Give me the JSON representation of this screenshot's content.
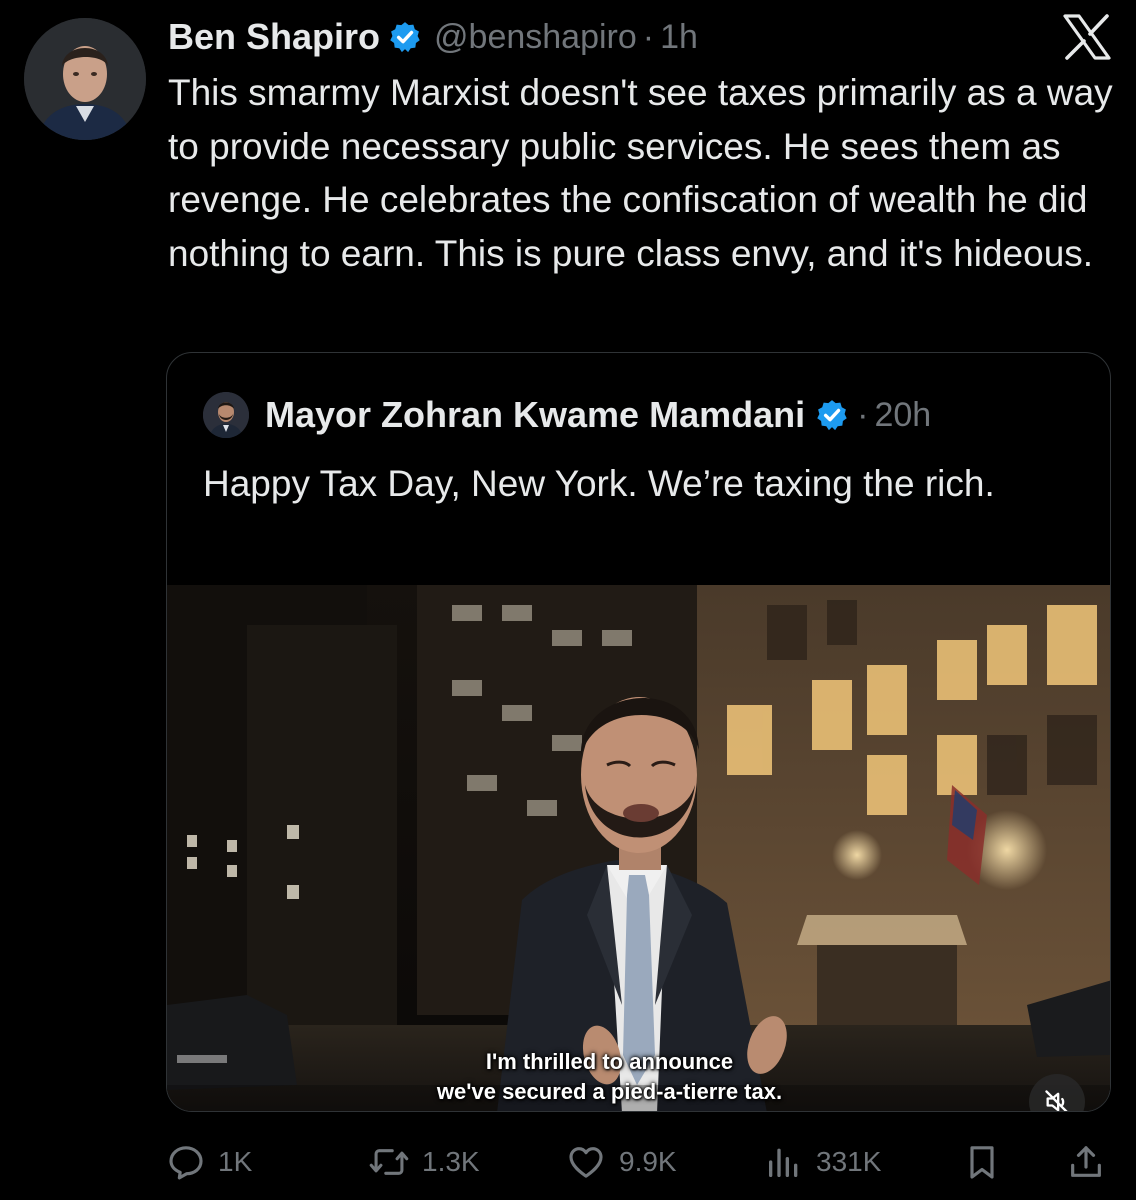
{
  "tweet": {
    "author": {
      "display_name": "Ben Shapiro",
      "handle": "@benshapiro",
      "verified": true
    },
    "separator": "·",
    "time": "1h",
    "text": "This smarmy Marxist doesn't see taxes primarily as a way to provide necessary public services. He sees them as revenge. He celebrates the confiscation of wealth he did nothing to earn. This is pure class envy, and it's hideous."
  },
  "quoted_tweet": {
    "author": {
      "display_name": "Mayor Zohran Kwame Mamdani",
      "verified": true
    },
    "separator": "·",
    "time": "20h",
    "text": "Happy Tax Day, New York. We’re taxing the rich.",
    "video": {
      "caption_line1": "I'm thrilled to announce",
      "caption_line2": "we've secured a pied-a-tierre tax.",
      "muted": true
    }
  },
  "actions": {
    "replies": "1K",
    "reposts": "1.3K",
    "likes": "9.9K",
    "views": "331K"
  },
  "icons": {
    "brand": "x-logo-icon",
    "verified_badge": "verified-badge-icon",
    "reply": "reply-icon",
    "repost": "repost-icon",
    "like": "heart-icon",
    "views": "views-icon",
    "bookmark": "bookmark-icon",
    "share": "share-icon",
    "mute": "speaker-muted-icon"
  },
  "colors": {
    "background": "#000000",
    "text_primary": "#e7e9ea",
    "text_secondary": "#71767b",
    "verified_blue": "#1d9bf0",
    "border": "#2f3336"
  }
}
